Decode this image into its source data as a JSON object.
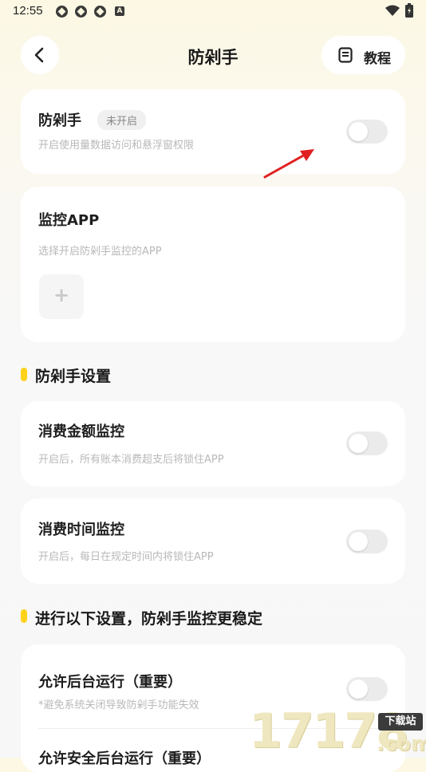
{
  "status_bar": {
    "time": "12:55",
    "notif_letter": "A"
  },
  "header": {
    "title": "防剁手",
    "tutorial_label": "教程"
  },
  "main_card": {
    "title": "防剁手",
    "badge": "未开启",
    "subtitle": "开启使用量数据访问和悬浮窗权限",
    "toggle_on": false
  },
  "monitor_card": {
    "title": "监控APP",
    "subtitle": "选择开启防剁手监控的APP",
    "add_label": "+"
  },
  "settings_section": {
    "title": "防剁手设置",
    "items": [
      {
        "title": "消费金额监控",
        "subtitle": "开启后，所有账本消费超支后将锁住APP",
        "toggle_on": false
      },
      {
        "title": "消费时间监控",
        "subtitle": "开启后，每日在规定时间内将锁住APP",
        "toggle_on": false
      }
    ]
  },
  "stability_section": {
    "title": "进行以下设置，防剁手监控更稳定",
    "items": [
      {
        "title": "允许后台运行（重要）",
        "subtitle": "*避免系统关闭导致防剁手功能失效",
        "toggle_on": false
      },
      {
        "title": "允许安全后台运行（重要）"
      }
    ]
  },
  "watermark": {
    "number": "17178",
    "tag": "下载站",
    "suffix": ".com"
  },
  "colors": {
    "accent_yellow": "#ffd21a",
    "arrow_red": "#e02020",
    "toggle_off": "#ebebeb"
  }
}
